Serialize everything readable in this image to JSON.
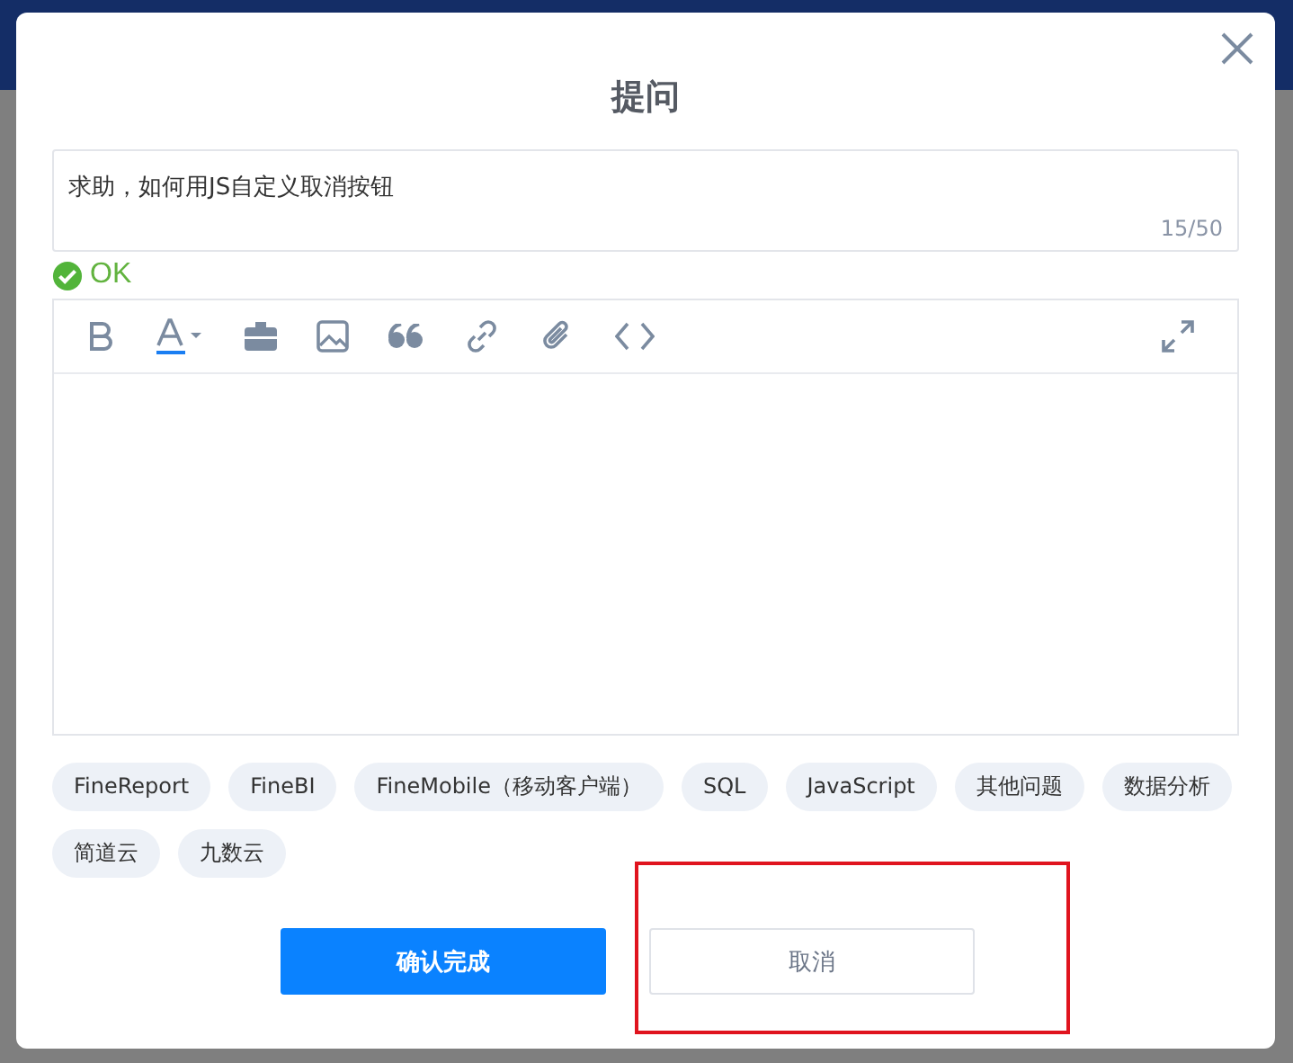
{
  "dialog": {
    "title": "提问"
  },
  "question": {
    "value": "求助，如何用JS自定义取消按钮",
    "counter": "15/50"
  },
  "validation": {
    "message": "OK"
  },
  "tags": [
    "FineReport",
    "FineBI",
    "FineMobile（移动客户端）",
    "SQL",
    "JavaScript",
    "其他问题",
    "数据分析",
    "简道云",
    "九数云"
  ],
  "buttons": [
    {
      "kind": "primary",
      "label": "确认完成"
    },
    {
      "kind": "secondary",
      "label": "取消"
    }
  ]
}
